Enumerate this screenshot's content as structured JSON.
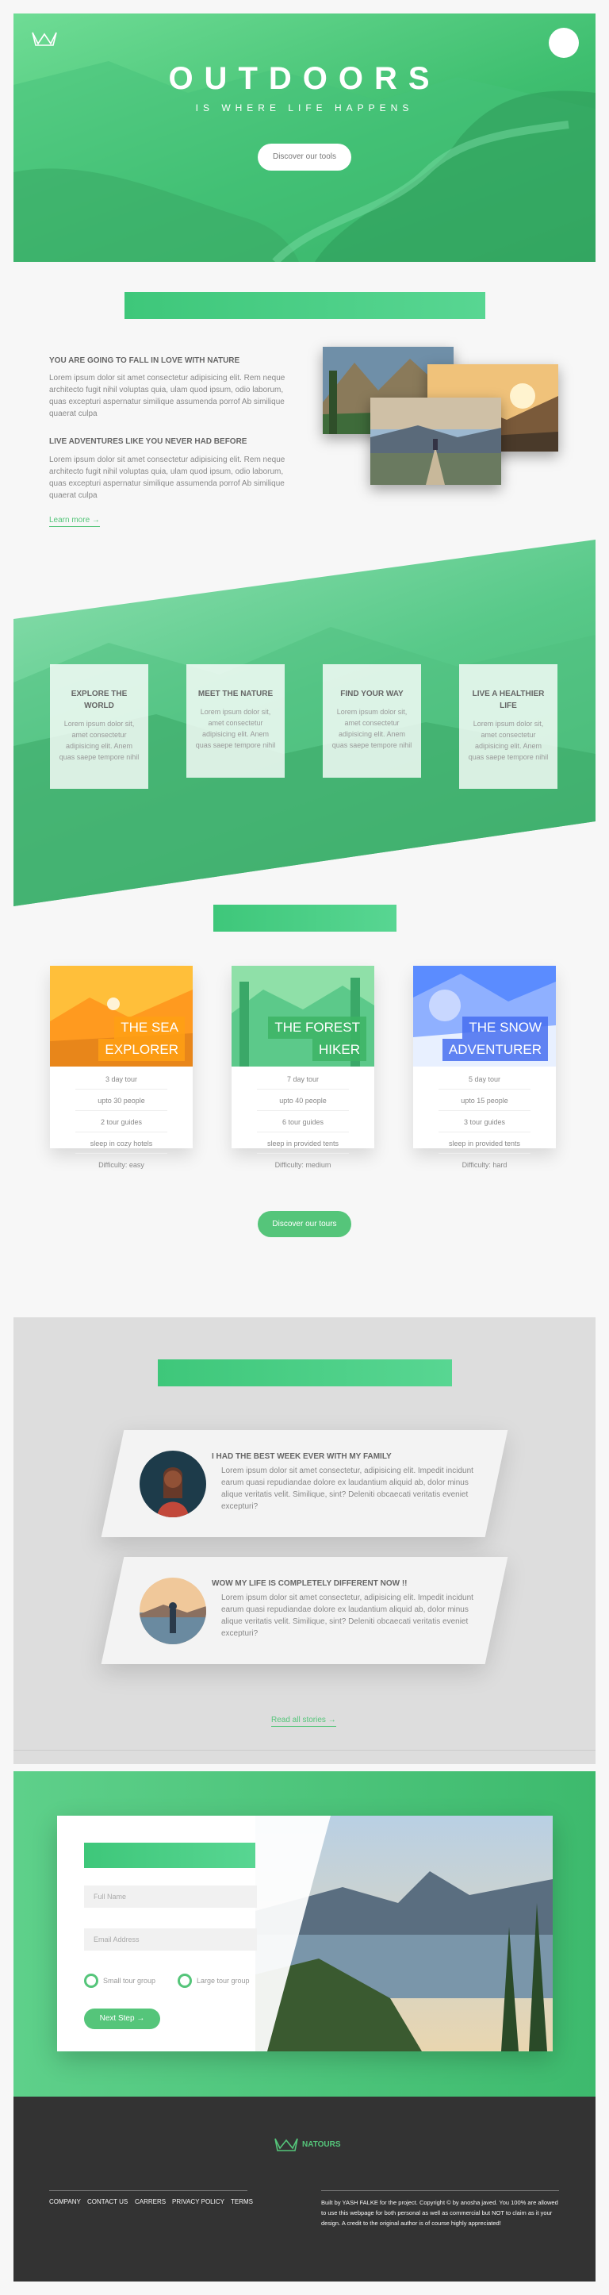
{
  "header": {
    "title": "OUTDOORS",
    "subtitle": "IS WHERE LIFE HAPPENS",
    "cta_label": "Discover our tools"
  },
  "about": {
    "heading1": "YOU ARE GOING TO FALL IN LOVE WITH NATURE",
    "text1": "Lorem ipsum dolor sit amet consectetur adipisicing elit. Rem neque architecto fugit nihil voluptas quia, ulam quod ipsum, odio laborum, quas excepturi aspernatur similique assumenda porrof Ab similique quaerat culpa",
    "heading2": "LIVE ADVENTURES LIKE YOU NEVER HAD BEFORE",
    "text2": "Lorem ipsum dolor sit amet consectetur adipisicing elit. Rem neque architecto fugit nihil voluptas quia, ulam quod ipsum, odio laborum, quas excepturi aspernatur similique assumenda porrof Ab similique quaerat culpa",
    "link_label": "Learn more →"
  },
  "features": [
    {
      "title": "EXPLORE THE WORLD",
      "text": "Lorem ipsum dolor sit, amet consectetur adipisicing elit. Anem quas saepe tempore nihil"
    },
    {
      "title": "MEET THE NATURE",
      "text": "Lorem ipsum dolor sit, amet consectetur adipisicing elit. Anem quas saepe tempore nihil"
    },
    {
      "title": "FIND YOUR WAY",
      "text": "Lorem ipsum dolor sit, amet consectetur adipisicing elit. Anem quas saepe tempore nihil"
    },
    {
      "title": "LIVE A HEALTHIER LIFE",
      "text": "Lorem ipsum dolor sit, amet consectetur adipisicing elit. Anem quas saepe tempore nihil"
    }
  ],
  "tours": [
    {
      "title_line1": "THE SEA",
      "title_line2": "EXPLORER",
      "details": [
        "3 day tour",
        "upto 30 people",
        "2 tour guides",
        "sleep in cozy hotels",
        "Difficulty: easy"
      ],
      "color": "#ffb900"
    },
    {
      "title_line1": "THE FOREST",
      "title_line2": "HIKER",
      "details": [
        "7 day tour",
        "upto 40 people",
        "6 tour guides",
        "sleep in provided tents",
        "Difficulty: medium"
      ],
      "color": "#7ed56f"
    },
    {
      "title_line1": "THE SNOW",
      "title_line2": "ADVENTURER",
      "details": [
        "5 day tour",
        "upto 15 people",
        "3 tour guides",
        "sleep in provided tents",
        "Difficulty: hard"
      ],
      "color": "#2998ff"
    }
  ],
  "tours_cta": "Discover our tours",
  "stories": [
    {
      "heading": "I HAD THE BEST WEEK EVER WITH MY FAMILY",
      "text": "Lorem ipsum dolor sit amet consectetur, adipisicing elit. Impedit incidunt earum quasi repudiandae dolore ex laudantium aliquid ab, dolor minus alique veritatis velit. Similique, sint? Deleniti obcaecati veritatis eveniet excepturi?"
    },
    {
      "heading": "WOW MY LIFE IS COMPLETELY DIFFERENT NOW !!",
      "text": "Lorem ipsum dolor sit amet consectetur, adipisicing elit. Impedit incidunt earum quasi repudiandae dolore ex laudantium aliquid ab, dolor minus alique veritatis velit. Similique, sint? Deleniti obcaecati veritatis eveniet excepturi?"
    }
  ],
  "stories_link": "Read all stories →",
  "booking": {
    "name_placeholder": "Full Name",
    "email_placeholder": "Email Address",
    "radio1": "Small tour group",
    "radio2": "Large tour group",
    "submit": "Next Step →"
  },
  "footer": {
    "brand": "NATOURS",
    "nav": [
      "COMPANY",
      "CONTACT US",
      "CARRERS",
      "PRIVACY POLICY",
      "TERMS"
    ],
    "copyright": "Built by YASH FALKE for the project. Copyright © by anosha javed. You 100% are allowed to use this webpage for both personal as well as commercial but NOT to claim as it your design. A credit to the original author is of course highly appreciated!"
  },
  "colors": {
    "primary": "#55c57a",
    "primary_dark": "#28b485",
    "background": "#f7f7f7",
    "footer": "#333333"
  }
}
